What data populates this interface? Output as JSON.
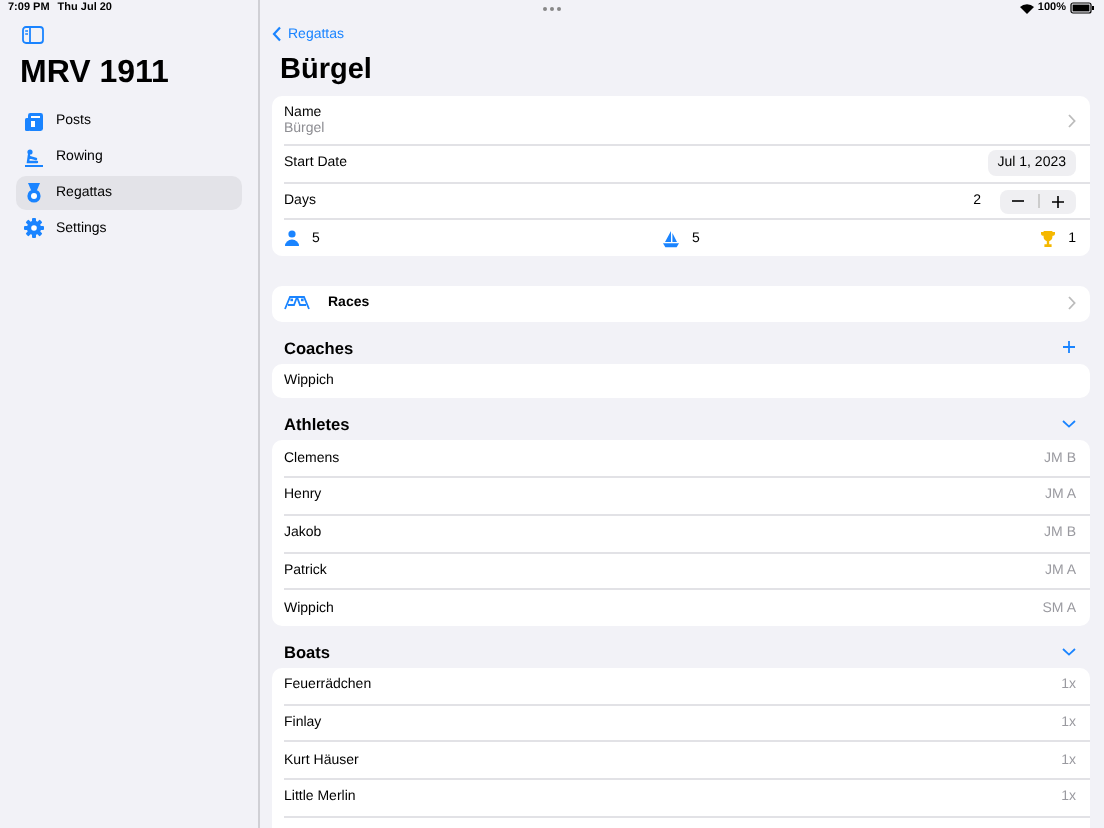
{
  "status_bar": {
    "time": "7:09 PM",
    "date": "Thu Jul 20",
    "battery": "100%"
  },
  "sidebar": {
    "title": "MRV 1911",
    "items": [
      {
        "label": "Posts",
        "selected": false
      },
      {
        "label": "Rowing",
        "selected": false
      },
      {
        "label": "Regattas",
        "selected": true
      },
      {
        "label": "Settings",
        "selected": false
      }
    ]
  },
  "detail": {
    "back": "Regattas",
    "title": "Bürgel",
    "name_label": "Name",
    "name_value": "Bürgel",
    "start_date_label": "Start Date",
    "start_date": "Jul 1, 2023",
    "days_label": "Days",
    "days": "2",
    "stats": [
      {
        "kind": "athletes",
        "value": "5"
      },
      {
        "kind": "boats",
        "value": "5"
      },
      {
        "kind": "trophies",
        "value": "1"
      }
    ],
    "races": "Races",
    "sections": [
      {
        "title": "Coaches",
        "kind": "add",
        "rows": [
          {
            "name": "Wippich"
          }
        ]
      },
      {
        "title": "Athletes",
        "kind": "collapse",
        "rows": [
          {
            "name": "Clemens",
            "detail": "JM B"
          },
          {
            "name": "Henry",
            "detail": "JM A"
          },
          {
            "name": "Jakob",
            "detail": "JM B"
          },
          {
            "name": "Patrick",
            "detail": "JM A"
          },
          {
            "name": "Wippich",
            "detail": "SM A"
          }
        ]
      },
      {
        "title": "Boats",
        "kind": "collapse",
        "rows": [
          {
            "name": "Feuerrädchen",
            "detail": "1x"
          },
          {
            "name": "Finlay",
            "detail": "1x"
          },
          {
            "name": "Kurt Häuser",
            "detail": "1x"
          },
          {
            "name": "Little Merlin",
            "detail": "1x"
          }
        ]
      }
    ]
  }
}
